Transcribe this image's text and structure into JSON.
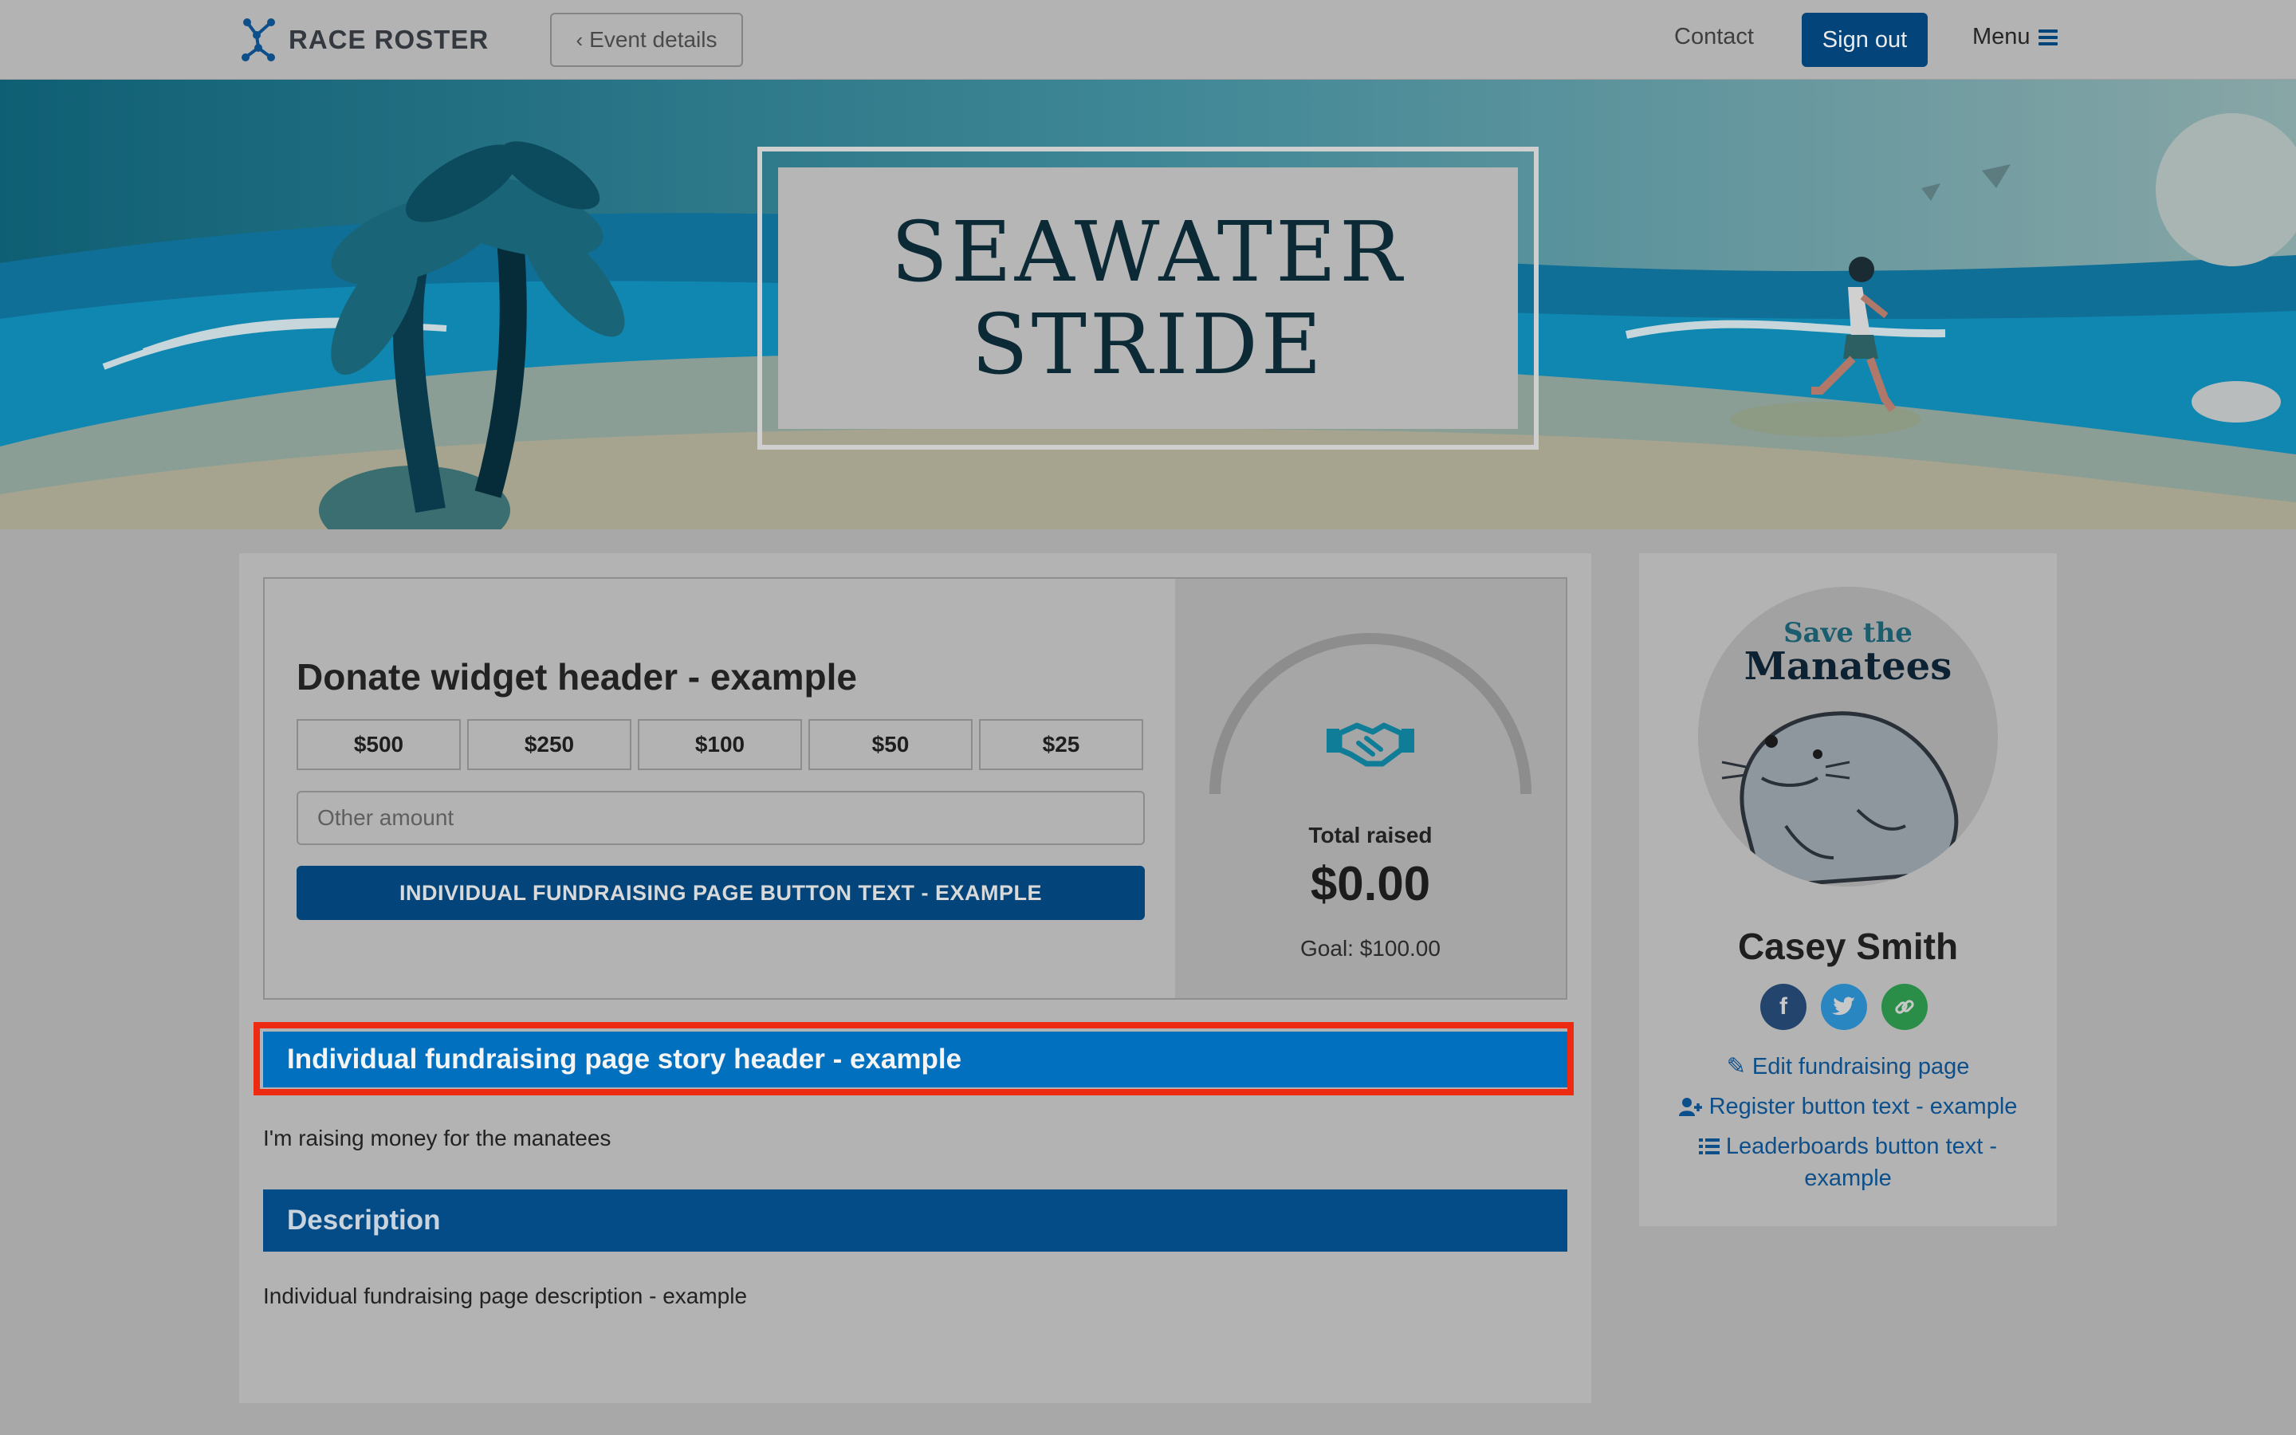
{
  "topbar": {
    "logo_text": "RACE ROSTER",
    "event_details_label": "Event details",
    "contact_label": "Contact",
    "signout_label": "Sign out",
    "menu_label": "Menu"
  },
  "banner": {
    "title_line1": "SEAWATER",
    "title_line2": "STRIDE"
  },
  "donate": {
    "header": "Donate widget header - example",
    "amounts": [
      "$500",
      "$250",
      "$100",
      "$50",
      "$25"
    ],
    "other_placeholder": "Other amount",
    "button_label": "INDIVIDUAL FUNDRAISING PAGE BUTTON TEXT - EXAMPLE",
    "total_label": "Total raised",
    "total_value": "$0.00",
    "goal": "Goal: $100.00",
    "progress_fraction": 0
  },
  "story": {
    "header": "Individual fundraising page story header - example",
    "text": "I'm raising money for the manatees"
  },
  "description": {
    "header": "Description",
    "text": "Individual fundraising page description - example"
  },
  "sidebar": {
    "avatar_top": "Save the",
    "avatar_main": "Manatees",
    "name": "Casey Smith",
    "socials": [
      "facebook-icon",
      "twitter-icon",
      "link-icon"
    ],
    "edit_link": "Edit fundraising page",
    "register_link": "Register button text - example",
    "leaderboards_link_line1": "Leaderboards button text -",
    "leaderboards_link_line2": "example"
  },
  "colors": {
    "brand_navy": "#03457a",
    "story_blue": "#0070bf",
    "highlight_red": "#ee2a12"
  }
}
